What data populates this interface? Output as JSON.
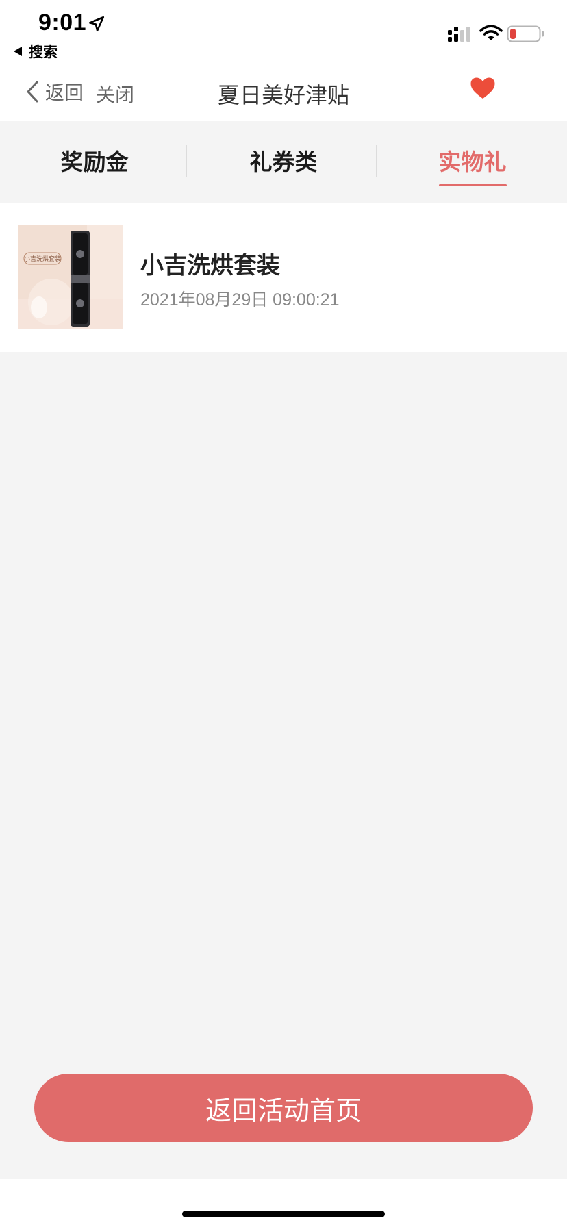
{
  "status_bar": {
    "time": "9:01",
    "back_app_label": "搜索",
    "battery_color": "#e0443e"
  },
  "nav": {
    "back_label": "返回",
    "close_label": "关闭",
    "title": "夏日美好津贴",
    "heart_color": "#ec4d3a"
  },
  "tabs": [
    {
      "label": "奖励金",
      "active": false
    },
    {
      "label": "礼券类",
      "active": false
    },
    {
      "label": "实物礼",
      "active": true
    }
  ],
  "accent_color": "#e26b6a",
  "list": {
    "items": [
      {
        "title": "小吉洗烘套装",
        "time": "2021年08月29日 09:00:21",
        "thumbnail_caption": "小吉洗烘套装"
      }
    ]
  },
  "bottom_button": {
    "label": "返回活动首页"
  }
}
